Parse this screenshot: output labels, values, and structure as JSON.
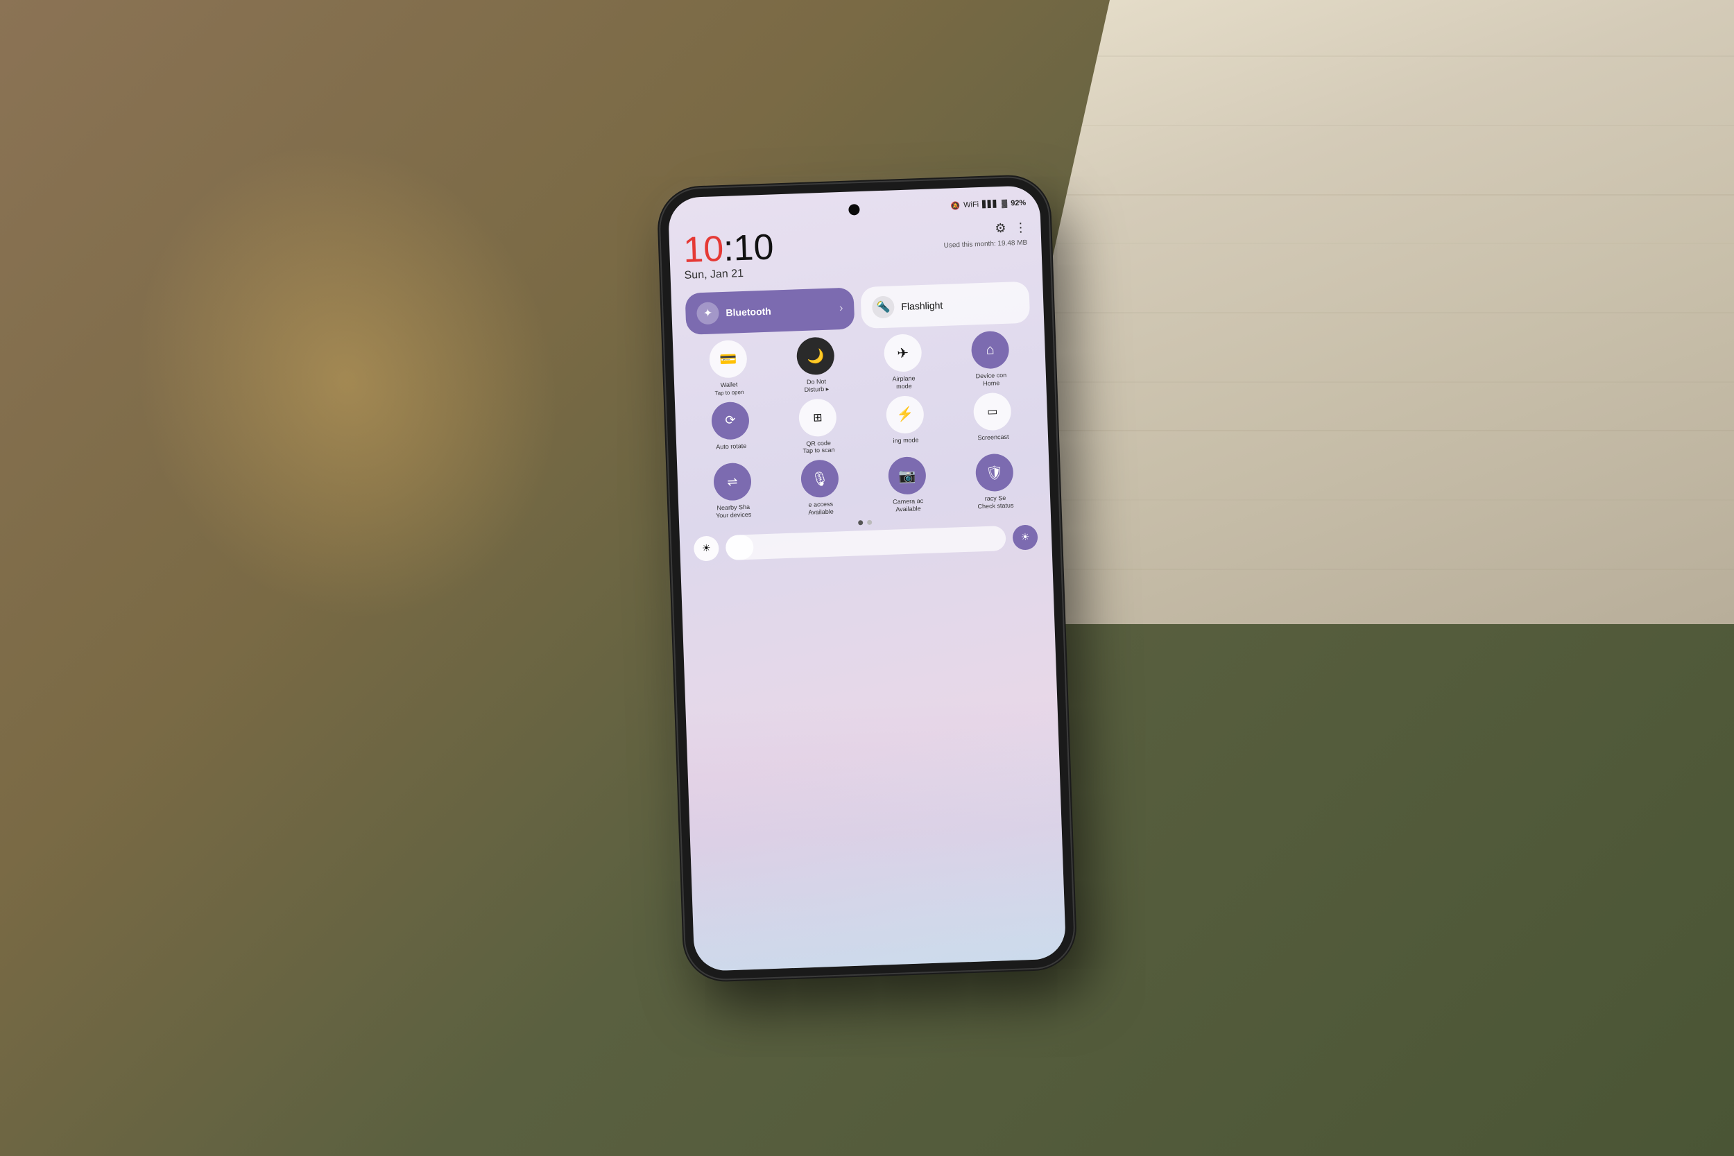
{
  "background": {
    "desk_color": "#6b6b4a",
    "wood_color": "#d4cbb8"
  },
  "phone": {
    "rotation": "-2deg"
  },
  "status_bar": {
    "mute_icon": "🔇",
    "wifi_icon": "📶",
    "signal_icon": "📶",
    "battery_icon": "🔋",
    "battery_percent": "92%",
    "data_usage": "Used this month: 19.48 MB"
  },
  "time": {
    "hour": "10",
    "colon": ":",
    "minutes": "10",
    "date": "Sun, Jan 21"
  },
  "header": {
    "settings_icon": "⚙",
    "more_icon": "⋮"
  },
  "bluetooth_tile": {
    "label": "Bluetooth",
    "icon": "✱",
    "arrow": "›",
    "active": true
  },
  "flashlight_tile": {
    "label": "Flashlight",
    "icon": "🔦"
  },
  "quick_tiles": [
    {
      "id": "wallet",
      "icon": "💳",
      "label": "Wallet",
      "sublabel": "Tap to open",
      "style": "white"
    },
    {
      "id": "do-not-disturb",
      "icon": "🌙",
      "label": "Do Not",
      "sublabel": "Disturb ▸",
      "style": "dark"
    },
    {
      "id": "airplane-mode",
      "icon": "✈",
      "label": "Airplane",
      "sublabel": "mode",
      "style": "white"
    },
    {
      "id": "device-control",
      "icon": "🏠",
      "label": "Device con",
      "sublabel": "Home",
      "style": "purple"
    },
    {
      "id": "auto-rotate",
      "icon": "↻",
      "label": "Auto rotate",
      "sublabel": "",
      "style": "purple"
    },
    {
      "id": "qr-code",
      "icon": "⊞",
      "label": "QR code",
      "sublabel": "Tap to scan",
      "style": "white"
    },
    {
      "id": "charging-mode",
      "icon": "⚡",
      "label": "ing mode",
      "sublabel": "",
      "style": "white"
    },
    {
      "id": "screencast",
      "icon": "📺",
      "label": "Screencast",
      "sublabel": "",
      "style": "white"
    },
    {
      "id": "nearby-share",
      "icon": "⇋",
      "label": "Nearby Sha",
      "sublabel": "Your devices",
      "style": "purple"
    },
    {
      "id": "mic-access",
      "icon": "🎙",
      "label": "e access",
      "sublabel": "Available",
      "style": "purple"
    },
    {
      "id": "camera-access",
      "icon": "📷",
      "label": "Camera ac",
      "sublabel": "Available",
      "style": "purple"
    },
    {
      "id": "privacy-security",
      "icon": "🛡",
      "label": "racy Se",
      "sublabel": "Check status",
      "style": "purple"
    }
  ],
  "brightness": {
    "sun_icon": "☀",
    "auto_icon": "☀"
  },
  "page_dots": [
    "active",
    "inactive"
  ]
}
